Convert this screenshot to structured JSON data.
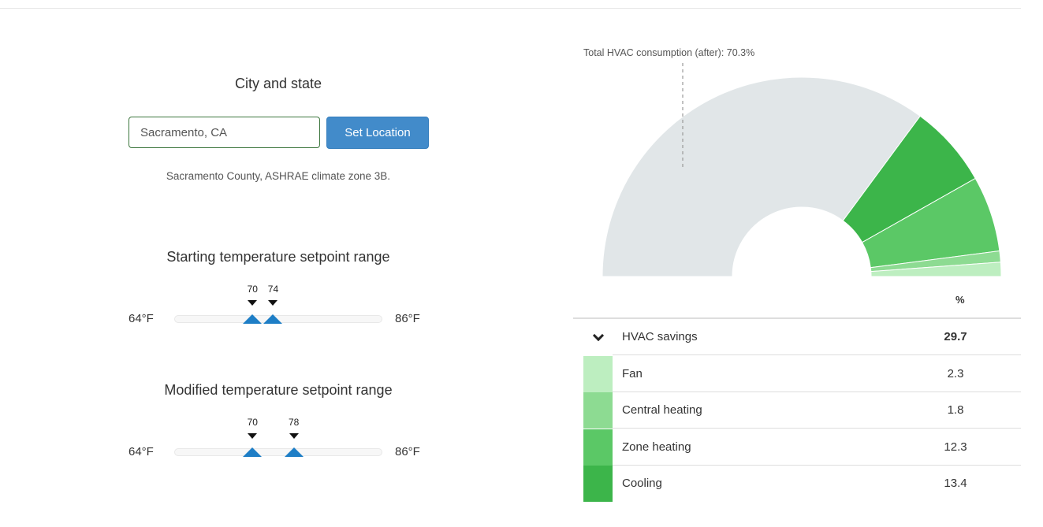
{
  "location": {
    "heading": "City and state",
    "input_value": "Sacramento, CA",
    "button_label": "Set Location",
    "climate_note": "Sacramento County, ASHRAE climate zone 3B."
  },
  "starting_range": {
    "heading": "Starting temperature setpoint range",
    "min_label": "64°F",
    "max_label": "86°F",
    "min": 64,
    "max": 86,
    "low": 70,
    "high": 74,
    "low_label": "70",
    "high_label": "74"
  },
  "modified_range": {
    "heading": "Modified temperature setpoint range",
    "min_label": "64°F",
    "max_label": "86°F",
    "min": 64,
    "max": 86,
    "low": 70,
    "high": 78,
    "low_label": "70",
    "high_label": "78"
  },
  "chart_data": {
    "type": "pie",
    "style": "half-donut",
    "annotation": "Total HVAC consumption (after): 70.3%",
    "remaining_label": "Total HVAC consumption (after)",
    "remaining_value": 70.3,
    "remaining_color": "#e1e6e8",
    "series": [
      {
        "name": "Cooling",
        "value": 13.4,
        "color": "#3cb54a"
      },
      {
        "name": "Zone heating",
        "value": 12.3,
        "color": "#5bc866"
      },
      {
        "name": "Central heating",
        "value": 1.8,
        "color": "#8ddb92"
      },
      {
        "name": "Fan",
        "value": 2.3,
        "color": "#bdeec0"
      }
    ]
  },
  "table": {
    "column_header": "%",
    "summary_label": "HVAC savings",
    "summary_value": "29.7",
    "rows": [
      {
        "label": "Fan",
        "value": "2.3",
        "color": "#bdeec0"
      },
      {
        "label": "Central heating",
        "value": "1.8",
        "color": "#8ddb92"
      },
      {
        "label": "Zone heating",
        "value": "12.3",
        "color": "#5bc866"
      },
      {
        "label": "Cooling",
        "value": "13.4",
        "color": "#3cb54a"
      }
    ]
  }
}
